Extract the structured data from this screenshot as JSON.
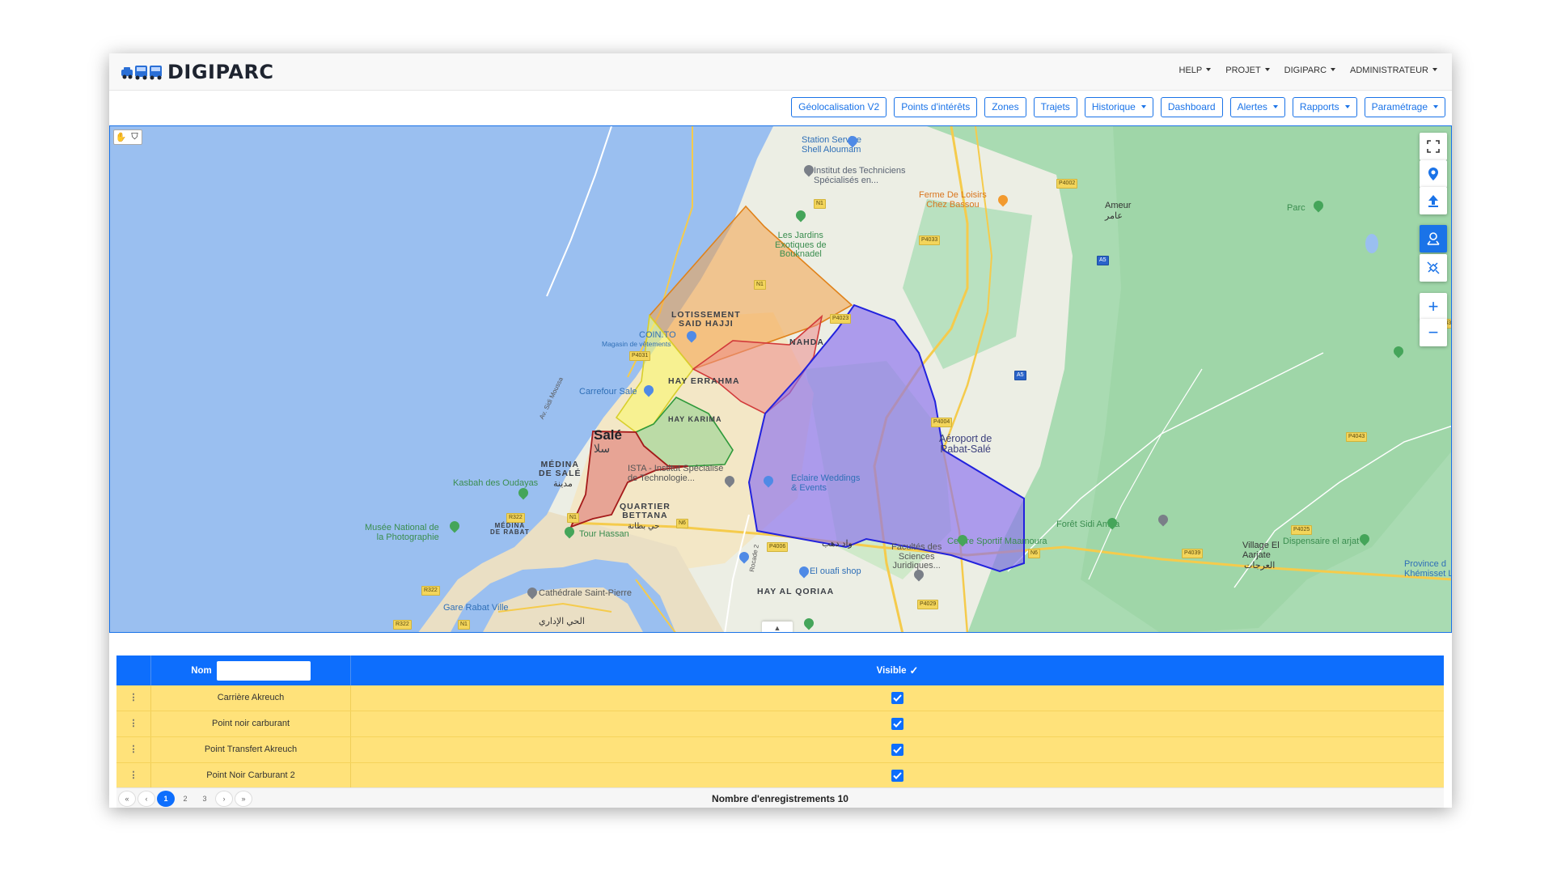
{
  "app": {
    "name": "DIGIPARC"
  },
  "topnav": [
    "HELP",
    "PROJET",
    "DIGIPARC",
    "ADMINISTRATEUR"
  ],
  "toolbar": [
    {
      "label": "Géolocalisation V2",
      "dropdown": false
    },
    {
      "label": "Points d'intérêts",
      "dropdown": false
    },
    {
      "label": "Zones",
      "dropdown": false
    },
    {
      "label": "Trajets",
      "dropdown": false
    },
    {
      "label": "Historique",
      "dropdown": true
    },
    {
      "label": "Dashboard",
      "dropdown": false
    },
    {
      "label": "Alertes",
      "dropdown": true
    },
    {
      "label": "Rapports",
      "dropdown": true
    },
    {
      "label": "Paramétrage",
      "dropdown": true
    }
  ],
  "map": {
    "labels": {
      "sale": "Salé",
      "sale_ar": "سلا",
      "airport": "Aéroport de\nRabat-Salé",
      "station": "Station Service\nShell Aloumam",
      "institut": "Institut des Techniciens\nSpécialisés en...",
      "ferme": "Ferme De Loisirs\nChez Bassou",
      "ameur": "Ameur",
      "ameur_ar": "عامر",
      "jardins": "Les Jardins\nExotiques de\nBouknadel",
      "lotissement": "LOTISSEMENT\nSAID HAJJI",
      "cointo": "COIN.TO",
      "cointo_sub": "Magasin de vêtements",
      "nahda": "NAHDA",
      "hay_errahma": "HAY ERRAHMA",
      "carrefour": "Carrefour Sale",
      "hay_karima": "HAY KARIMA",
      "medina": "MÉDINA\nDE SALÉ",
      "medina_ar": "مدينة",
      "ista": "ISTA - Institut Spécialisé\nde Technologie...",
      "eclaire": "Eclaire Weddings\n& Events",
      "kasbah": "Kasbah des Oudayas",
      "quartier": "QUARTIER\nBETTANA",
      "quartier_ar": "حي بطانة",
      "musee": "Musée National de\nla Photographie",
      "medina_rabat": "MÉDINA\nDE RABAT",
      "tour": "Tour Hassan",
      "oued": "واد دهب",
      "facultes": "Facultés des\nSciences\nJuridiques...",
      "centre": "Centre Sportif Maamoura",
      "foret": "Forêt Sidi Amira",
      "village": "Village El\nAarjate",
      "village_ar": "العرجات",
      "dispensaire": "Dispensaire el arjat",
      "province": "Province d\nKhémisset Lo",
      "ouafi": "El ouafi shop",
      "hay_qoriaa": "HAY AL QORIAA",
      "cathedrale": "Cathédrale Saint-Pierre",
      "gare": "Gare Rabat Ville",
      "hay_idari": "الحي الإداري",
      "parc": "Parc",
      "road_av": "Av. Sidi Moussa",
      "rocade": "Rocade 2"
    },
    "road_tags": [
      "N1",
      "N1",
      "P4002",
      "P4033",
      "A5",
      "P4031",
      "P4023",
      "P4043",
      "A5",
      "P4004",
      "P4043",
      "N6",
      "P4006",
      "P4029",
      "N6",
      "P4039",
      "P4025",
      "R322",
      "R322",
      "R322",
      "N1",
      "N1"
    ]
  },
  "grid": {
    "header": {
      "name_label": "Nom",
      "visible_label": "Visible"
    },
    "rows": [
      {
        "name": "Carrière Akreuch",
        "visible": true
      },
      {
        "name": "Point noir carburant",
        "visible": true
      },
      {
        "name": "Point Transfert Akreuch",
        "visible": true
      },
      {
        "name": "Point Noir Carburant 2",
        "visible": true
      }
    ],
    "pager": {
      "pages": [
        "1",
        "2",
        "3"
      ],
      "current": "1",
      "count_text": "Nombre d'enregistrements 10"
    }
  },
  "colors": {
    "accent": "#0d6efd",
    "row": "#ffe27a"
  }
}
